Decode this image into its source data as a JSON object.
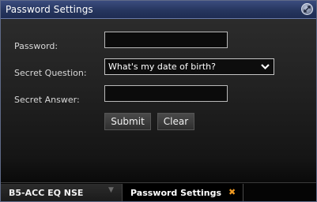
{
  "window": {
    "title": "Password Settings"
  },
  "form": {
    "password_label": "Password:",
    "password_value": "",
    "question_label": "Secret Question:",
    "question_selected": "What's my date of birth?",
    "answer_label": "Secret Answer:",
    "answer_value": "",
    "submit_label": "Submit",
    "clear_label": "Clear"
  },
  "taskbar": {
    "tabs": [
      {
        "label": "B5-ACC EQ NSE"
      },
      {
        "label": "Password Settings"
      }
    ]
  },
  "icons": {
    "restore": "restore-arrows-icon",
    "dropdown": "chevron-down-icon",
    "close": "close-x-icon"
  },
  "colors": {
    "titlebar": "#26365f",
    "close_accent": "#f09a22"
  }
}
